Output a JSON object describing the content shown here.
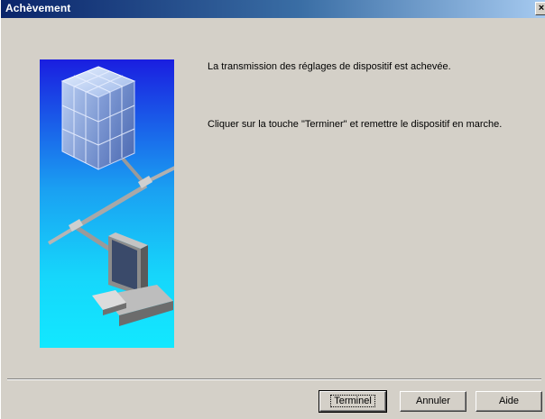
{
  "window": {
    "title": "Achèvement",
    "close_glyph": "✕"
  },
  "messages": {
    "line1": "La transmission des réglages de dispositif est achevée.",
    "line2": "Cliquer sur la touche \"Terminer\" et remettre le dispositif en marche."
  },
  "buttons": {
    "finish": "Terminel",
    "cancel": "Annuler",
    "help": "Aide"
  },
  "illustration": {
    "icons": [
      "data-cube-icon",
      "network-cable-icon",
      "computer-monitor-icon"
    ]
  }
}
